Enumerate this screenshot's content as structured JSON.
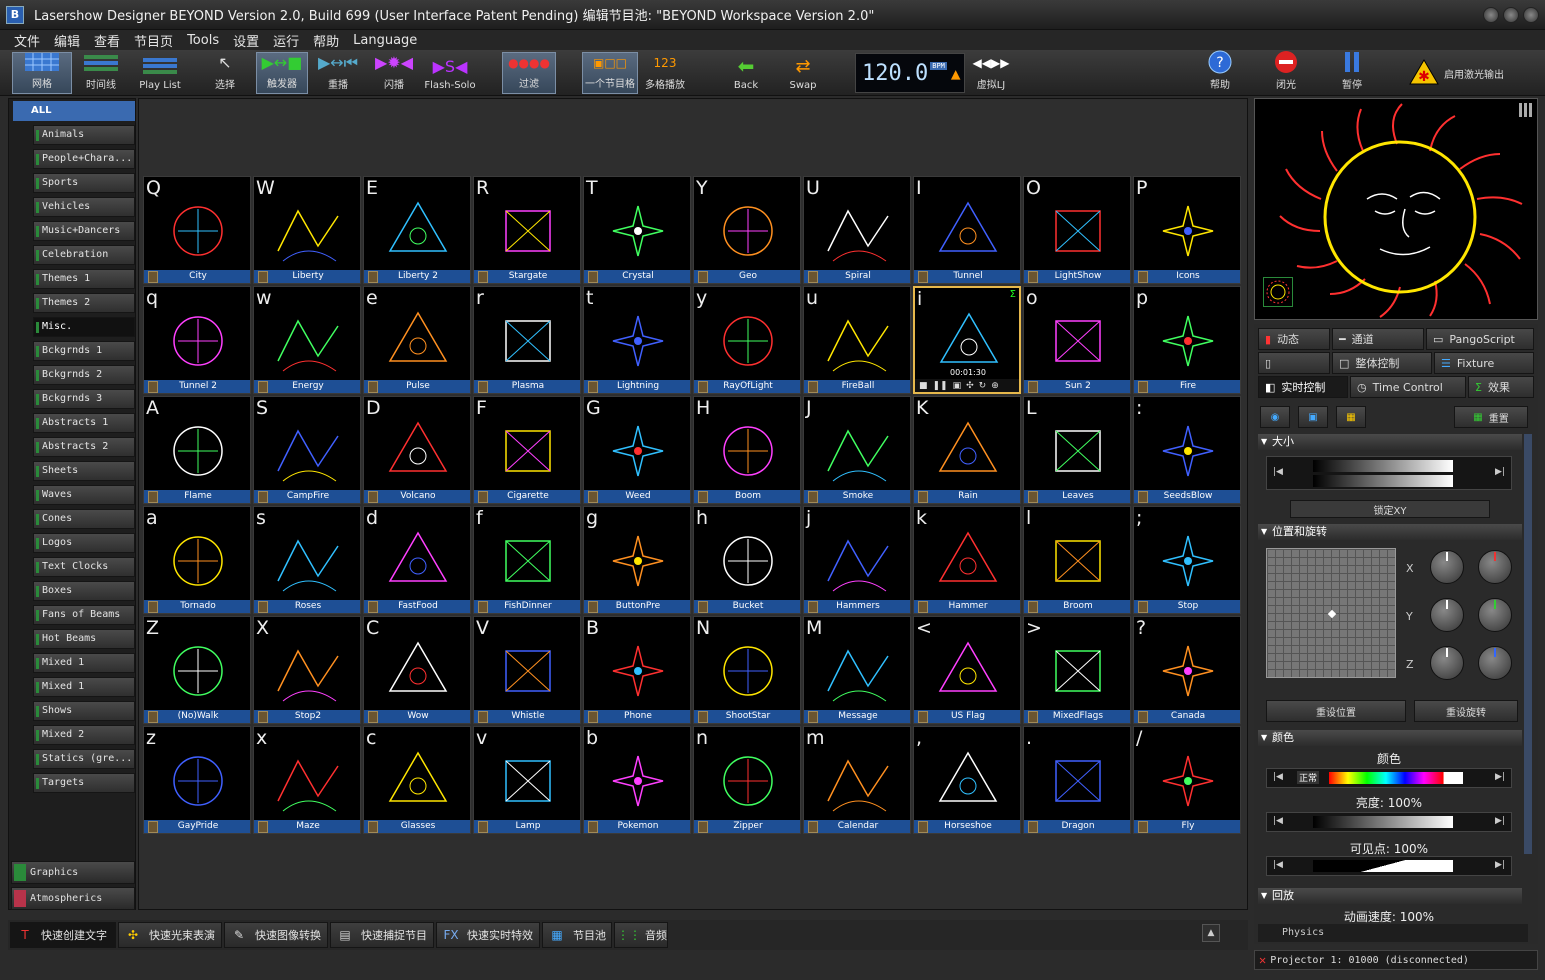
{
  "window": {
    "title": "Lasershow Designer BEYOND   Version 2.0, Build 699   (User Interface Patent Pending)  编辑节目池: \"BEYOND Workspace Version 2.0\""
  },
  "menu": [
    "文件",
    "编辑",
    "查看",
    "节目页",
    "Tools",
    "设置",
    "运行",
    "帮助",
    "Language"
  ],
  "toolbar": {
    "grid": "网格",
    "timeline": "时间线",
    "playlist": "Play List",
    "select": "选择",
    "trigger": "触发器",
    "replay": "重播",
    "flash": "闪播",
    "flashsolo": "Flash-Solo",
    "filter": "过滤",
    "single_cue": "一个节目格",
    "multi_cue": "多格播放",
    "back": "Back",
    "swap": "Swap",
    "bpm": "120.0",
    "bpm_unit": "BPM",
    "virtual": "虚拟LJ",
    "help": "帮助",
    "blackout": "闭光",
    "pause": "暂停",
    "laser_enable": "启用激光输出"
  },
  "sidebar": {
    "all": "ALL",
    "categories": [
      "Animals",
      "People+Chara...",
      "Sports",
      "Vehicles",
      "Music+Dancers",
      "Celebration",
      "Themes 1",
      "Themes 2",
      "Misc.",
      "Bckgrnds 1",
      "Bckgrnds 2",
      "Bckgrnds 3",
      "Abstracts 1",
      "Abstracts 2",
      "Sheets",
      "Waves",
      "Cones",
      "Logos",
      "Text  Clocks",
      "Boxes",
      "Fans of Beams",
      "Hot Beams",
      "Mixed 1",
      "Mixed 1",
      "Shows",
      "Mixed 2",
      "Statics (gre...",
      "Targets"
    ],
    "bottom_tabs": [
      "Graphics",
      "Atmospherics"
    ]
  },
  "grid": {
    "rows": [
      [
        [
          "Q",
          "City"
        ],
        [
          "W",
          "Liberty"
        ],
        [
          "E",
          "Liberty 2"
        ],
        [
          "R",
          "Stargate"
        ],
        [
          "T",
          "Crystal"
        ],
        [
          "Y",
          "Geo"
        ],
        [
          "U",
          "Spiral"
        ],
        [
          "I",
          "Tunnel"
        ],
        [
          "O",
          "LightShow"
        ],
        [
          "P",
          "Icons"
        ]
      ],
      [
        [
          "q",
          "Tunnel 2"
        ],
        [
          "w",
          "Energy"
        ],
        [
          "e",
          "Pulse"
        ],
        [
          "r",
          "Plasma"
        ],
        [
          "t",
          "Lightning"
        ],
        [
          "y",
          "RayOfLight"
        ],
        [
          "u",
          "FireBall"
        ],
        [
          "i",
          ""
        ],
        [
          "o",
          "Sun 2"
        ],
        [
          "p",
          "Fire"
        ]
      ],
      [
        [
          "A",
          "Flame"
        ],
        [
          "S",
          "CampFire"
        ],
        [
          "D",
          "Volcano"
        ],
        [
          "F",
          "Cigarette"
        ],
        [
          "G",
          "Weed"
        ],
        [
          "H",
          "Boom"
        ],
        [
          "J",
          "Smoke"
        ],
        [
          "K",
          "Rain"
        ],
        [
          "L",
          "Leaves"
        ],
        [
          ":",
          "SeedsBlow"
        ]
      ],
      [
        [
          "a",
          "Tornado"
        ],
        [
          "s",
          "Roses"
        ],
        [
          "d",
          "FastFood"
        ],
        [
          "f",
          "FishDinner"
        ],
        [
          "g",
          "ButtonPre"
        ],
        [
          "h",
          "Bucket"
        ],
        [
          "j",
          "Hammers"
        ],
        [
          "k",
          "Hammer"
        ],
        [
          "l",
          "Broom"
        ],
        [
          ";",
          "Stop"
        ]
      ],
      [
        [
          "Z",
          "(No)Walk"
        ],
        [
          "X",
          "Stop2"
        ],
        [
          "C",
          "Wow"
        ],
        [
          "V",
          "Whistle"
        ],
        [
          "B",
          "Phone"
        ],
        [
          "N",
          "ShootStar"
        ],
        [
          "M",
          "Message"
        ],
        [
          "<",
          "US Flag"
        ],
        [
          ">",
          "MixedFlags"
        ],
        [
          "?",
          "Canada"
        ]
      ],
      [
        [
          "z",
          "GayPride"
        ],
        [
          "x",
          "Maze"
        ],
        [
          "c",
          "Glasses"
        ],
        [
          "v",
          "Lamp"
        ],
        [
          "b",
          "Pokemon"
        ],
        [
          "n",
          "Zipper"
        ],
        [
          "m",
          "Calendar"
        ],
        [
          ",",
          "Horseshoe"
        ],
        [
          ".",
          "Dragon"
        ],
        [
          "/",
          "Fly"
        ]
      ]
    ],
    "active_timer": "00:01:30"
  },
  "bottom_tabs": [
    "快速创建文字",
    "快速光束表演",
    "快速图像转换",
    "快速捕捉节目",
    "快速实时特效",
    "节目池",
    "音频"
  ],
  "right_tabs": {
    "row1": [
      "动态",
      "通道",
      "PangoScript"
    ],
    "row2": [
      "",
      "整体控制",
      "Fixture"
    ],
    "row3": [
      "实时控制",
      "Time Control",
      "效果"
    ]
  },
  "live": {
    "reset": "重置",
    "size": "大小",
    "lock_xy": "锁定XY",
    "pos_rot": "位置和旋转",
    "x": "X",
    "y": "Y",
    "z": "Z",
    "reset_pos": "重设位置",
    "reset_rot": "重设旋转",
    "color_head": "颜色",
    "color_label": "颜色",
    "normal": "正常",
    "brightness": "亮度: 100%",
    "visible": "可见点:  100%",
    "playback": "回放",
    "anim_speed": "动画速度:  100%",
    "physics": "Physics"
  },
  "status": "Projector 1: 01000 (disconnected)"
}
